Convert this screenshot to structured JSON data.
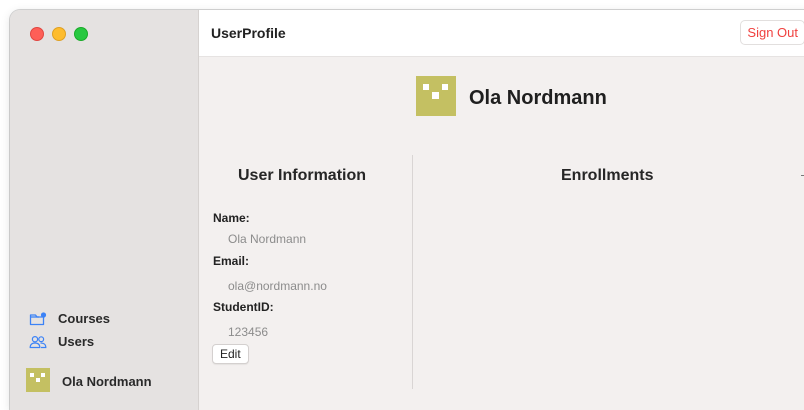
{
  "colors": {
    "accent": "#f0413f",
    "avatar": "#c4c062",
    "avatar_marks": "#ffffff",
    "icon_blue": "#3b82f6"
  },
  "toolbar": {
    "title": "UserProfile",
    "sign_out_label": "Sign Out"
  },
  "sidebar": {
    "items": [
      {
        "label": "Courses",
        "icon": "folder-badge-icon"
      },
      {
        "label": "Users",
        "icon": "people-icon"
      }
    ],
    "current_user": {
      "name": "Ola Nordmann",
      "icon": "avatar-icon"
    }
  },
  "profile": {
    "name": "Ola Nordmann"
  },
  "user_information": {
    "title": "User Information",
    "fields": [
      {
        "label": "Name:",
        "value": "Ola Nordmann"
      },
      {
        "label": "Email:",
        "value": "ola@nordmann.no"
      },
      {
        "label": "StudentID:",
        "value": "123456"
      }
    ],
    "edit_label": "Edit"
  },
  "enrollments": {
    "title": "Enrollments"
  }
}
